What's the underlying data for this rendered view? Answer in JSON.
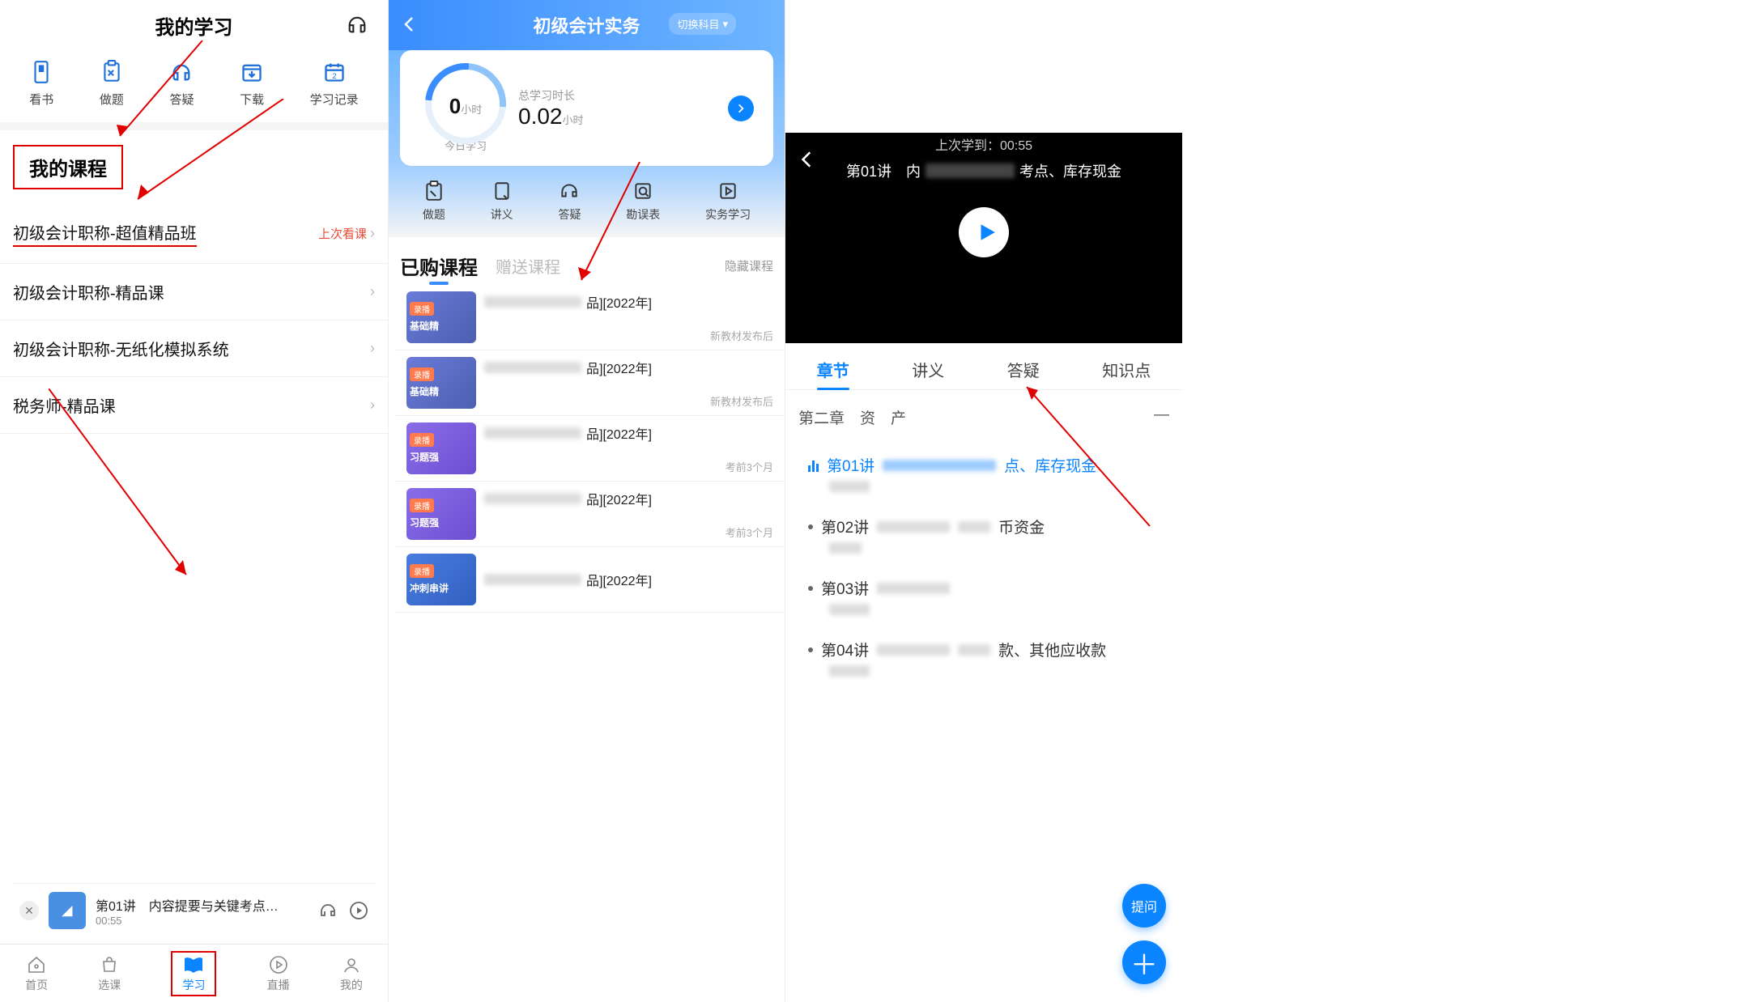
{
  "panel1": {
    "title": "我的学习",
    "tools": [
      {
        "label": "看书"
      },
      {
        "label": "做题"
      },
      {
        "label": "答疑"
      },
      {
        "label": "下载"
      },
      {
        "label": "学习记录"
      }
    ],
    "section_title": "我的课程",
    "courses": [
      {
        "name": "初级会计职称-超值精品班",
        "right": "上次看课"
      },
      {
        "name": "初级会计职称-精品课"
      },
      {
        "name": "初级会计职称-无纸化模拟系统"
      },
      {
        "name": "税务师-精品课"
      }
    ],
    "mini": {
      "title": "第01讲　内容提要与关键考点…",
      "time": "00:55"
    },
    "tabs": [
      {
        "label": "首页"
      },
      {
        "label": "选课"
      },
      {
        "label": "学习"
      },
      {
        "label": "直播"
      },
      {
        "label": "我的"
      }
    ]
  },
  "panel2": {
    "title": "初级会计实务",
    "switch_label": "切换科目",
    "gauge": {
      "num": "0",
      "unit": "小时",
      "sub": "今日学习"
    },
    "stat": {
      "label": "总学习时长",
      "val": "0.02",
      "unit": "小时"
    },
    "tools": [
      {
        "label": "做题"
      },
      {
        "label": "讲义"
      },
      {
        "label": "答疑"
      },
      {
        "label": "勘误表"
      },
      {
        "label": "实务学习"
      }
    ],
    "tabs": {
      "purchased": "已购课程",
      "gift": "赠送课程",
      "hide": "隐藏课程"
    },
    "lessons": [
      {
        "badge": "录播",
        "bn": "基础精",
        "suffix": "品][2022年]",
        "sub": "新教材发布后"
      },
      {
        "badge": "录播",
        "bn": "基础精",
        "suffix": "品][2022年]",
        "sub": "新教材发布后"
      },
      {
        "badge": "录播",
        "bn": "习题强",
        "suffix": "品][2022年]",
        "sub": "考前3个月"
      },
      {
        "badge": "录播",
        "bn": "习题强",
        "suffix": "品][2022年]",
        "sub": "考前3个月"
      },
      {
        "badge": "录播",
        "bn": "冲刺串讲",
        "suffix": "品][2022年]",
        "sub": ""
      }
    ]
  },
  "panel3": {
    "last_label": "上次学到：",
    "last_time": "00:55",
    "lecture_prefix": "第01讲　内",
    "lecture_suffix": "考点、库存现金",
    "tabs": {
      "chapter": "章节",
      "notes": "讲义",
      "qa": "答疑",
      "points": "知识点"
    },
    "chapter_title": "第二章　资　产",
    "chapter_toggle": "—",
    "items": [
      {
        "no": "第01讲",
        "suffix": "点、库存现金"
      },
      {
        "no": "第02讲",
        "suffix": "币资金"
      },
      {
        "no": "第03讲"
      },
      {
        "no": "第04讲",
        "suffix": "款、其他应收款"
      }
    ],
    "ask_label": "提问"
  }
}
